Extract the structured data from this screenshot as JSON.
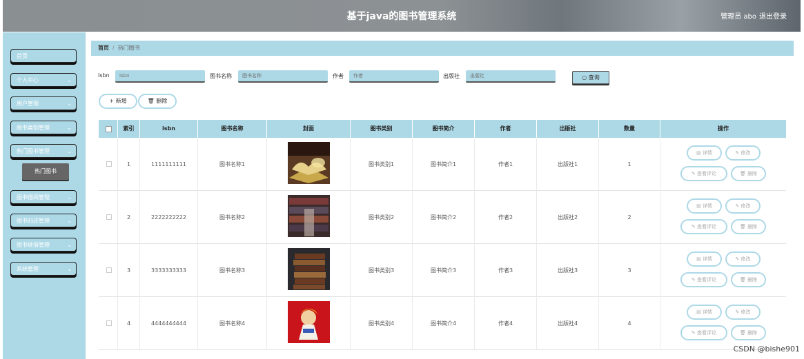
{
  "header": {
    "title": "基于java的图书管理系统",
    "user": "管理员 abo",
    "logout": "退出登录"
  },
  "sidebar": {
    "items": [
      {
        "label": "首页",
        "chevron": ""
      },
      {
        "label": "个人中心",
        "chevron": "⌄"
      },
      {
        "label": "用户管理",
        "chevron": "⌄"
      },
      {
        "label": "图书类别管理",
        "chevron": "⌄"
      },
      {
        "label": "热门图书管理",
        "chevron": "⌄"
      },
      {
        "label": "图书借阅管理",
        "chevron": "⌄"
      },
      {
        "label": "图书归还管理",
        "chevron": "⌄"
      },
      {
        "label": "图书续借管理",
        "chevron": "⌄"
      },
      {
        "label": "系统管理",
        "chevron": "⌄"
      }
    ],
    "active_sub": "热门图书"
  },
  "breadcrumb": {
    "home": "首页",
    "sep": "/",
    "current": "热门图书"
  },
  "search": {
    "isbn_label": "Isbn",
    "isbn_placeholder": "Isbn",
    "name_label": "图书名称",
    "name_placeholder": "图书名称",
    "author_label": "作者",
    "author_placeholder": "作者",
    "publisher_label": "出版社",
    "publisher_placeholder": "出版社",
    "button": "查询"
  },
  "actions": {
    "add": "新增",
    "delete": "删除"
  },
  "table": {
    "headers": [
      "",
      "索引",
      "isbn",
      "图书名称",
      "封面",
      "图书类别",
      "图书简介",
      "作者",
      "出版社",
      "数量",
      "操作"
    ],
    "row_actions": {
      "detail": "详情",
      "edit": "修改",
      "comments": "查看评论",
      "delete": "删除"
    },
    "rows": [
      {
        "index": "1",
        "isbn": "1111111111",
        "name": "图书名称1",
        "category": "图书类别1",
        "intro": "图书简介1",
        "author": "作者1",
        "publisher": "出版社1",
        "qty": "1"
      },
      {
        "index": "2",
        "isbn": "2222222222",
        "name": "图书名称2",
        "category": "图书类别2",
        "intro": "图书简介2",
        "author": "作者2",
        "publisher": "出版社2",
        "qty": "2"
      },
      {
        "index": "3",
        "isbn": "3333333333",
        "name": "图书名称3",
        "category": "图书类别3",
        "intro": "图书简介3",
        "author": "作者3",
        "publisher": "出版社3",
        "qty": "3"
      },
      {
        "index": "4",
        "isbn": "4444444444",
        "name": "图书名称4",
        "category": "图书类别4",
        "intro": "图书简介4",
        "author": "作者4",
        "publisher": "出版社4",
        "qty": "4"
      }
    ]
  },
  "watermark": "CSDN @bishe901",
  "colors": {
    "accent": "#add8e6",
    "header": "#8a8f92",
    "active_sub": "#666666"
  }
}
